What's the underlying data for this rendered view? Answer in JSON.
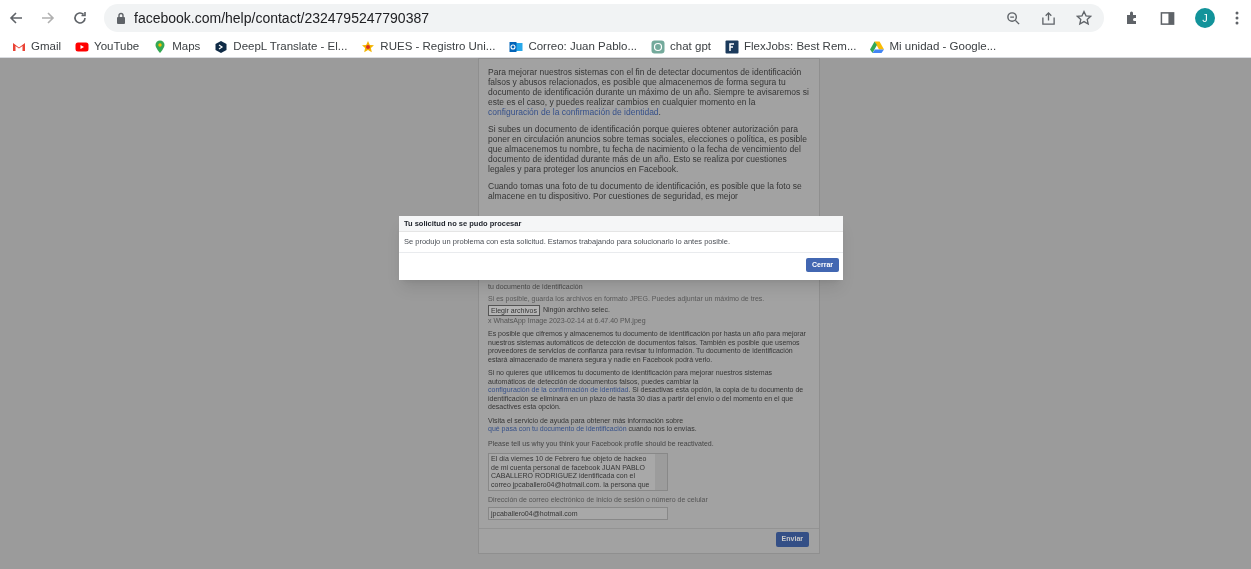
{
  "browser": {
    "url": "facebook.com/help/contact/2324795247790387",
    "profile_initial": "J",
    "bookmarks": [
      {
        "label": "Gmail",
        "kind": "gmail"
      },
      {
        "label": "YouTube",
        "kind": "youtube"
      },
      {
        "label": "Maps",
        "kind": "maps"
      },
      {
        "label": "DeepL Translate - El...",
        "kind": "deepl"
      },
      {
        "label": "RUES - Registro Uni...",
        "kind": "star"
      },
      {
        "label": "Correo: Juan Pablo...",
        "kind": "outlook"
      },
      {
        "label": "chat gpt",
        "kind": "chatgpt"
      },
      {
        "label": "FlexJobs: Best Rem...",
        "kind": "flexjobs"
      },
      {
        "label": "Mi unidad - Google...",
        "kind": "drive"
      }
    ]
  },
  "form": {
    "top_paragraphs": [
      {
        "before": "Para mejorar nuestros sistemas con el fin de detectar documentos de identificación falsos y abusos relacionados, es posible que almacenemos de forma segura tu documento de identificación durante un máximo de un año. Siempre te avisaremos si este es el caso, y puedes realizar cambios en cualquier momento en la ",
        "link": "configuración de la confirmación de identidad",
        "after": "."
      },
      {
        "before": "Si subes un documento de identificación porque quieres obtener autorización para poner en circulación anuncios sobre temas sociales, elecciones o política, es posible que almacenemos tu nombre, tu fecha de nacimiento o la fecha de vencimiento del documento de identidad durante más de un año. Esto se realiza por cuestiones legales y para proteger los anuncios en Facebook."
      },
      {
        "before": "Cuando tomas una foto de tu documento de identificación, es posible que la foto se almacene en tu dispositivo. Por cuestiones de seguridad, es mejor"
      }
    ],
    "cut_line": "tu documento de identificación",
    "file_hint": "Si es posible, guarda los archivos en formato JPEG. Puedes adjuntar un máximo de tres.",
    "file_button": "Elegir archivos",
    "file_status": "Ningún archivo selec.",
    "file_name": "x WhatsApp Image 2023-02-14 at 6.47.40 PM.jpeg",
    "bottom_paragraphs": [
      {
        "before": "Es posible que cifremos y almacenemos tu documento de identificación por hasta un año para mejorar nuestros sistemas automáticos de detección de documentos falsos. También es posible que usemos proveedores de servicios de confianza para revisar tu información. Tu documento de identificación estará almacenado de manera segura y nadie en Facebook podrá verlo."
      },
      {
        "before": "Si no quieres que utilicemos tu documento de identificación para mejorar nuestros sistemas automáticos de detección de documentos falsos, puedes cambiar la ",
        "link": "configuración de la confirmación de identidad",
        "after": ". Si desactivas esta opción, la copia de tu documento de identificación se eliminará en un plazo de hasta 30 días a partir del envío o del momento en el que desactives esta opción."
      },
      {
        "before": "Visita el servicio de ayuda para obtener más información sobre ",
        "link": "qué pasa con tu documento de identificación",
        "after": " cuando nos lo envías."
      }
    ],
    "question_label": "Please tell us why you think your Facebook profile should be reactivated.",
    "answer": "El día viernes 10 de Febrero fue objeto de hackeo de mi cuenta personal de facebook JUAN PABLO CABALLERO RODRIGUEZ identificada con el correo jpcaballero04@hotmail.com. la persona que",
    "email_label": "Dirección de correo electrónico de inicio de sesión o número de celular",
    "email_value": "jpcaballero04@hotmail.com",
    "submit": "Enviar"
  },
  "dialog": {
    "title": "Tu solicitud no se pudo procesar",
    "message": "Se produjo un problema con esta solicitud. Estamos trabajando para solucionarlo lo antes posible.",
    "button": "Cerrar"
  }
}
